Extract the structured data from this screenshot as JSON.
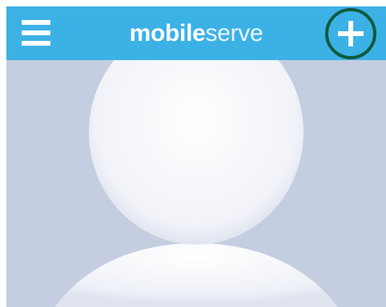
{
  "header": {
    "brand_bold": "mobile",
    "brand_light": "serve",
    "menu_icon": "hamburger-menu-icon",
    "add_icon": "plus-icon"
  },
  "colors": {
    "header_background": "#3cb1e6",
    "content_background": "#c5cde0",
    "avatar_fill": "#f4f6fb",
    "add_button_ring": "#0f5a3e"
  },
  "content": {
    "avatar_icon": "default-user-avatar-icon"
  }
}
